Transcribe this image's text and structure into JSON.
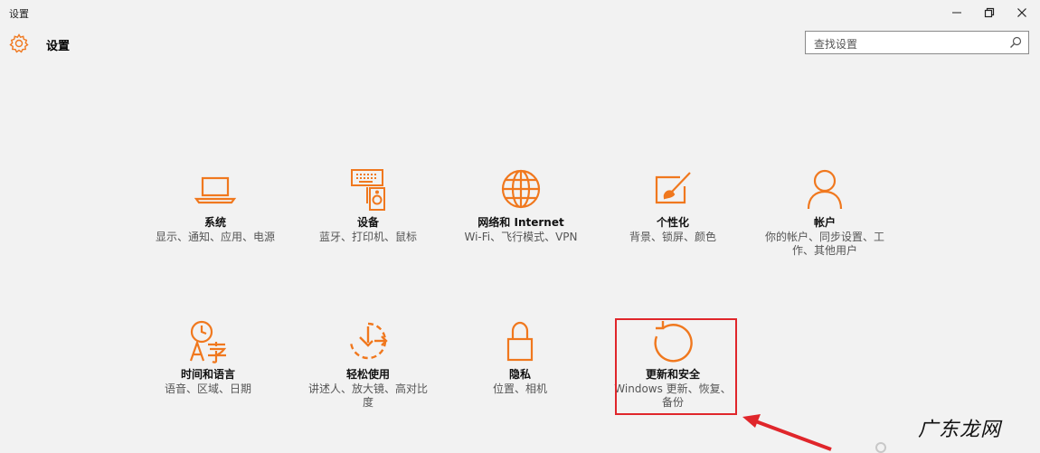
{
  "window": {
    "title": "设置",
    "controls": [
      "minimize",
      "restore",
      "close"
    ]
  },
  "header": {
    "icon": "gear-icon",
    "title": "设置"
  },
  "search": {
    "placeholder": "查找设置",
    "icon": "search-icon"
  },
  "tiles": [
    {
      "id": "system",
      "icon": "laptop-icon",
      "name": "系统",
      "desc": "显示、通知、应用、电源"
    },
    {
      "id": "devices",
      "icon": "devices-icon",
      "name": "设备",
      "desc": "蓝牙、打印机、鼠标"
    },
    {
      "id": "network",
      "icon": "globe-icon",
      "name": "网络和 Internet",
      "desc": "Wi-Fi、飞行模式、VPN"
    },
    {
      "id": "personalization",
      "icon": "paintbrush-icon",
      "name": "个性化",
      "desc": "背景、锁屏、颜色"
    },
    {
      "id": "accounts",
      "icon": "person-icon",
      "name": "帐户",
      "desc": "你的帐户、同步设置、工作、其他用户"
    },
    {
      "id": "time-language",
      "icon": "time-language-icon",
      "name": "时间和语言",
      "desc": "语音、区域、日期"
    },
    {
      "id": "ease-of-access",
      "icon": "ease-of-access-icon",
      "name": "轻松使用",
      "desc": "讲述人、放大镜、高对比度"
    },
    {
      "id": "privacy",
      "icon": "lock-icon",
      "name": "隐私",
      "desc": "位置、相机"
    },
    {
      "id": "update-security",
      "icon": "refresh-icon",
      "name": "更新和安全",
      "desc": "Windows 更新、恢复、备份"
    }
  ],
  "colors": {
    "accent": "#f0781e",
    "background": "#f2f2f2",
    "highlight": "#e0262b"
  },
  "watermark": "广东龙网"
}
